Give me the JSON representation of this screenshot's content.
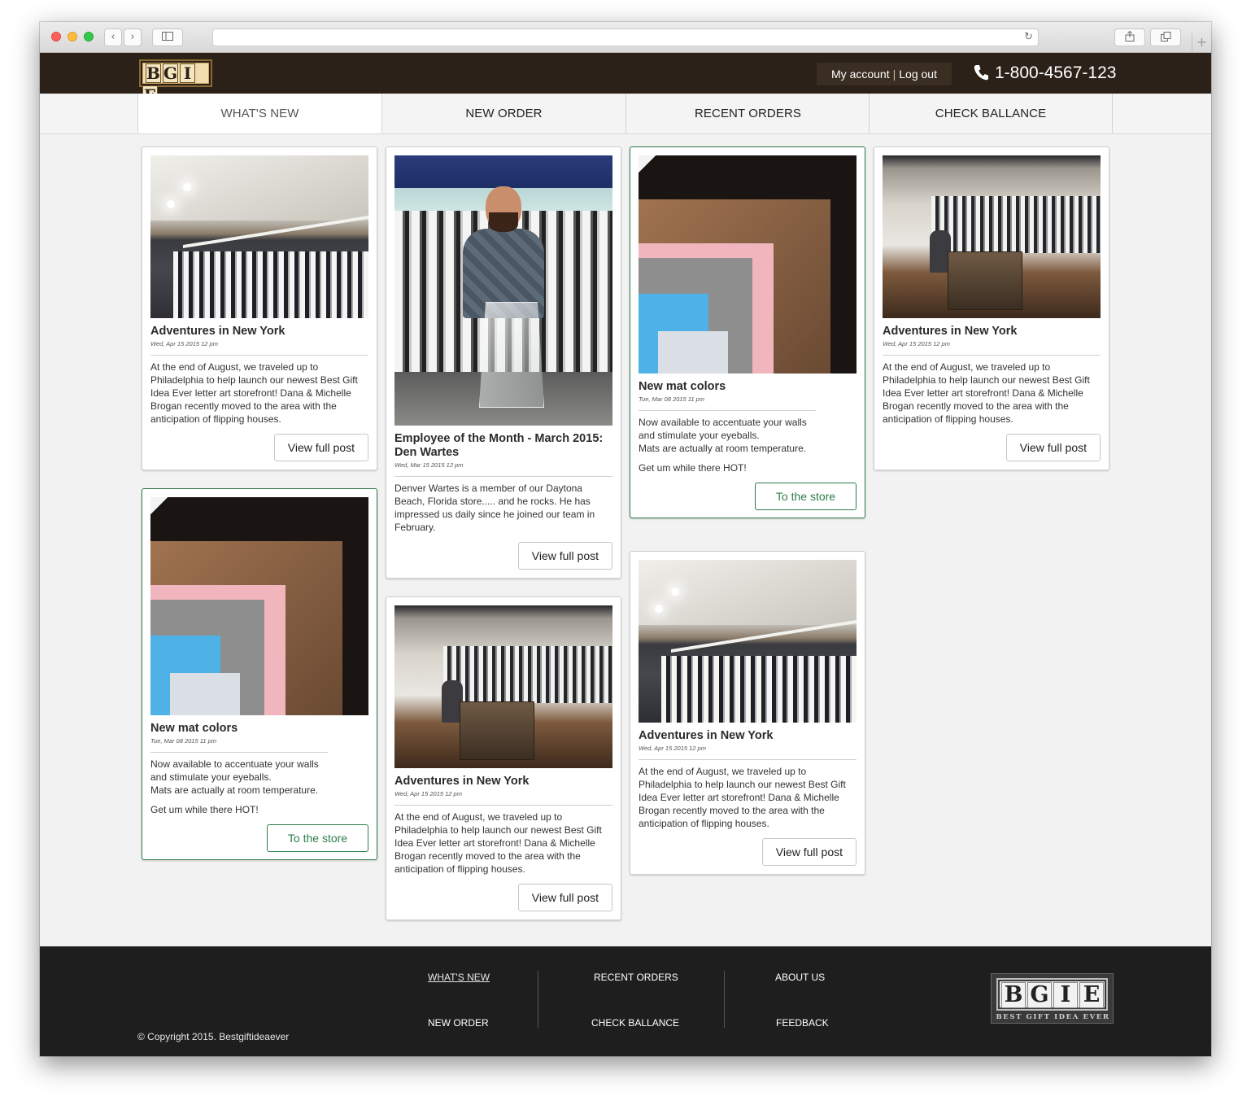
{
  "header": {
    "logo_letters": [
      "B",
      "G",
      "I",
      "E"
    ],
    "account_label": "My account",
    "logout_label": "Log out",
    "phone": "1-800-4567-123"
  },
  "nav": {
    "items": [
      {
        "label": "WHAT'S NEW",
        "active": true
      },
      {
        "label": "NEW ORDER",
        "active": false
      },
      {
        "label": "RECENT ORDERS",
        "active": false
      },
      {
        "label": "CHECK BALLANCE",
        "active": false
      }
    ]
  },
  "posts": {
    "p1": {
      "title": "Adventures in New York",
      "date": "Wed, Apr 15 2015 12 pm",
      "text": "At the end of August, we traveled up to Philadelphia to help launch our newest Best Gift Idea Ever letter art storefront! Dana & Michelle Brogan recently moved to the area with the anticipation of flipping houses.",
      "button": "View full post",
      "photo": "store-wall-photo"
    },
    "p2": {
      "title": "New mat colors",
      "date": "Tue, Mar 08 2015 11 pm",
      "text": "Now available to accentuate your walls and stimulate your eyeballs.\nMats are actually at room temperature.",
      "text2": "Get um while there HOT!",
      "button": "To the store",
      "photo": "mat-corner-photo"
    },
    "p3": {
      "title": "Employee of the Month - March 2015: Den Wartes",
      "date": "Wed, Mar 15 2015 12 pm",
      "text": "Denver Wartes is a member of our Daytona Beach, Florida store..... and he rocks.  He has impressed us daily since he joined our team in February.",
      "button": "View full post",
      "photo": "employee-trophy-photo"
    },
    "p4": {
      "title": "Adventures in New York",
      "date": "Wed, Apr 15 2015 12 pm",
      "text": "At the end of August, we traveled up to Philadelphia to help launch our newest Best Gift Idea Ever letter art storefront! Dana & Michelle Brogan recently moved to the area with the anticipation of flipping houses.",
      "button": "View full post",
      "photo": "store-counter-photo"
    },
    "p5": {
      "title": "New mat colors",
      "date": "Tue, Mar 08 2015 11 pm",
      "text": "Now available to accentuate your walls and stimulate your eyeballs.\nMats are actually at room temperature.",
      "text2": "Get um while there HOT!",
      "button": "To the store",
      "photo": "mat-corner-photo"
    },
    "p6": {
      "title": "Adventures in New York",
      "date": "Wed, Apr 15 2015 12 pm",
      "text": "At the end of August, we traveled up to Philadelphia to help launch our newest Best Gift Idea Ever letter art storefront! Dana & Michelle Brogan recently moved to the area with the anticipation of flipping houses.",
      "button": "View full post",
      "photo": "store-wall-photo"
    },
    "p7": {
      "title": "Adventures in New York",
      "date": "Wed, Apr 15 2015 12 pm",
      "text": "At the end of August, we traveled up to Philadelphia to help launch our newest Best Gift Idea Ever letter art storefront! Dana & Michelle Brogan recently moved to the area with the anticipation of flipping houses.",
      "button": "View full post",
      "photo": "store-counter-photo"
    }
  },
  "footer": {
    "links": {
      "whats_new": "WHAT'S NEW",
      "new_order": "NEW ORDER",
      "recent_orders": "RECENT ORDERS",
      "check_ballance": "CHECK BALLANCE",
      "about_us": "ABOUT US",
      "feedback": "FEEDBACK"
    },
    "copyright": "© Copyright 2015. Bestgiftideaever",
    "logo_letters": [
      "B",
      "G",
      "I",
      "E"
    ],
    "logo_tagline": "BEST GIFT IDEA EVER"
  },
  "colors": {
    "header_bg": "#2c2118",
    "accent_green": "#2e7d4a",
    "footer_bg": "#1e1e1e",
    "page_bg": "#f2f2f2"
  }
}
